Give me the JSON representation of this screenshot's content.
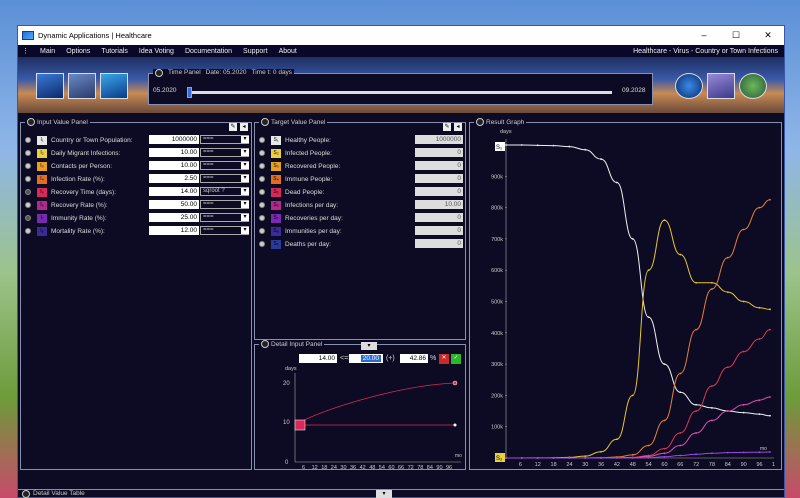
{
  "titlebar": {
    "title": "Dynamic Applications | Healthcare",
    "minimize": "–",
    "maximize": "☐",
    "close": "✕"
  },
  "menu": {
    "items": [
      "Main",
      "Options",
      "Tutorials",
      "Idea Voting",
      "Documentation",
      "Support",
      "About"
    ],
    "right": "Healthcare - Virus - Country or Town Infections"
  },
  "time_panel": {
    "title": "Time Panel",
    "date": "Date:  05.2020",
    "time": "Time t:  0  days",
    "start": "05.2020",
    "end": "09.2028",
    "progress": 0
  },
  "input_panel": {
    "title": "Input Value Panel",
    "rows": [
      {
        "label": "Country or Town Population:",
        "value": "1000000",
        "opt": "===",
        "sym": "I₁",
        "color": "#e8e8e8",
        "checked": true
      },
      {
        "label": "Daily Migrant Infections:",
        "value": "10.00",
        "opt": "===",
        "sym": "I₂",
        "color": "#e8d040",
        "checked": true
      },
      {
        "label": "Contacts per Person:",
        "value": "10.00",
        "opt": "===",
        "sym": "I₃",
        "color": "#e8a020",
        "checked": true
      },
      {
        "label": "Infection Rate (%):",
        "value": "2.50",
        "opt": "===",
        "sym": "I₄",
        "color": "#e07020",
        "checked": true
      },
      {
        "label": "Recovery Time (days):",
        "value": "14.00",
        "opt": "sqroot ?",
        "sym": "I₅",
        "color": "#d82a5a",
        "checked": false
      },
      {
        "label": "Recovery Rate (%):",
        "value": "50.00",
        "opt": "===",
        "sym": "I₆",
        "color": "#b02a8a",
        "checked": true
      },
      {
        "label": "Immunity Rate (%):",
        "value": "25.00",
        "opt": "===",
        "sym": "I₇",
        "color": "#7a2ab0",
        "checked": false
      },
      {
        "label": "Mortality Rate (%):",
        "value": "12.00",
        "opt": "===",
        "sym": "I₈",
        "color": "#3a2a9a",
        "checked": true
      }
    ]
  },
  "target_panel": {
    "title": "Target Value Panel",
    "rows": [
      {
        "label": "Healthy People:",
        "value": "1000000",
        "sym": "S₁",
        "color": "#e8e8e8"
      },
      {
        "label": "Infected People:",
        "value": "0",
        "sym": "S₂",
        "color": "#e8d040"
      },
      {
        "label": "Recovered People:",
        "value": "0",
        "sym": "S₃",
        "color": "#e8a020"
      },
      {
        "label": "Immune People:",
        "value": "0",
        "sym": "S₄",
        "color": "#e07020"
      },
      {
        "label": "Dead People:",
        "value": "0",
        "sym": "S₅",
        "color": "#d82a5a"
      },
      {
        "label": "Infections per day:",
        "value": "10.00",
        "sym": "S₆",
        "color": "#b02a8a"
      },
      {
        "label": "Recoveries per day:",
        "value": "0",
        "sym": "S₇",
        "color": "#7a2ab0"
      },
      {
        "label": "Immunities per day:",
        "value": "0",
        "sym": "S₈",
        "color": "#3a2a9a"
      },
      {
        "label": "Deaths per day:",
        "value": "0",
        "sym": "S₉",
        "color": "#2a3a9a"
      }
    ]
  },
  "detail_input": {
    "title": "Detail Input Panel",
    "v1": "14.00",
    "arrow": "<=>",
    "v2": "20.00",
    "op": "(+)",
    "pct": "42.86",
    "pct_sign": "%",
    "cancel": "✕",
    "ok": "✓",
    "y_label": "days",
    "x_label": "mo",
    "yticks": [
      "20",
      "10",
      "0"
    ],
    "xticks": [
      "6",
      "12",
      "18",
      "24",
      "30",
      "36",
      "42",
      "48",
      "54",
      "60",
      "66",
      "72",
      "78",
      "84",
      "90",
      "96"
    ],
    "x_end": "1"
  },
  "result_graph": {
    "title": "Result Graph",
    "y_label": "days",
    "x_label": "mo",
    "yticks": [
      "1M",
      "900k",
      "800k",
      "700k",
      "600k",
      "500k",
      "400k",
      "300k",
      "200k",
      "100k",
      "0"
    ],
    "xticks": [
      "6",
      "12",
      "18",
      "24",
      "30",
      "36",
      "42",
      "48",
      "54",
      "60",
      "66",
      "72",
      "78",
      "84",
      "90",
      "96"
    ],
    "x_end": "1",
    "top_marker": "S₁",
    "bottom_marker": "S₂"
  },
  "bottom": {
    "title": "Detail Value Table"
  },
  "chart_data": {
    "type": "line",
    "xlabel": "mo",
    "ylabel": "days",
    "ylim": [
      0,
      1000000
    ],
    "x": [
      0,
      6,
      12,
      18,
      24,
      30,
      36,
      42,
      48,
      54,
      60,
      66,
      72,
      78,
      84,
      90,
      96,
      100
    ],
    "series": [
      {
        "color": "#f0f0f0",
        "values": [
          1000000,
          1000000,
          999000,
          998000,
          995000,
          985000,
          955000,
          880000,
          700000,
          450000,
          300000,
          210000,
          170000,
          160000,
          150000,
          145000,
          140000,
          135000
        ]
      },
      {
        "color": "#e8c830",
        "values": [
          0,
          100,
          300,
          800,
          2000,
          6000,
          20000,
          60000,
          200000,
          600000,
          760000,
          650000,
          560000,
          560000,
          530000,
          500000,
          480000,
          475000
        ]
      },
      {
        "color": "#e88030",
        "values": [
          0,
          0,
          0,
          0,
          0,
          200,
          1000,
          3000,
          10000,
          40000,
          120000,
          270000,
          410000,
          540000,
          640000,
          730000,
          800000,
          825000
        ]
      },
      {
        "color": "#d83a50",
        "values": [
          0,
          0,
          0,
          0,
          0,
          0,
          200,
          800,
          2000,
          8000,
          30000,
          80000,
          150000,
          230000,
          290000,
          340000,
          380000,
          410000
        ]
      },
      {
        "color": "#e050b0",
        "values": [
          0,
          0,
          0,
          0,
          0,
          0,
          100,
          500,
          1500,
          5000,
          15000,
          40000,
          80000,
          120000,
          150000,
          170000,
          185000,
          195000
        ]
      },
      {
        "color": "#9a4ae0",
        "values": [
          0,
          0,
          0,
          0,
          0,
          0,
          0,
          0,
          200,
          1000,
          4000,
          8000,
          12000,
          15000,
          17000,
          18000,
          18500,
          19000
        ]
      }
    ]
  }
}
